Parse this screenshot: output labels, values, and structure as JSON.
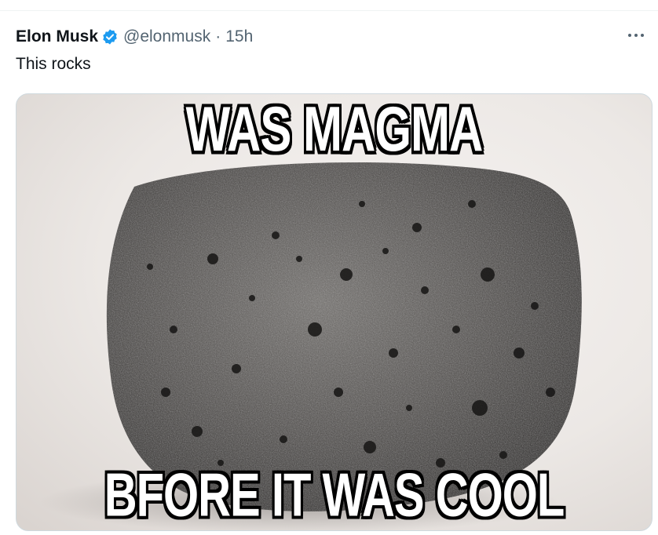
{
  "tweet": {
    "author_name": "Elon Musk",
    "handle": "@elonmusk",
    "separator": "·",
    "time": "15h",
    "text": "This rocks",
    "verified_icon": "verified-badge-icon",
    "more_icon": "more-options-icon",
    "verified_color": "#1d9bf0"
  },
  "media": {
    "caption_top": "WAS MAGMA",
    "caption_bottom": "BFORE IT WAS COOL"
  }
}
